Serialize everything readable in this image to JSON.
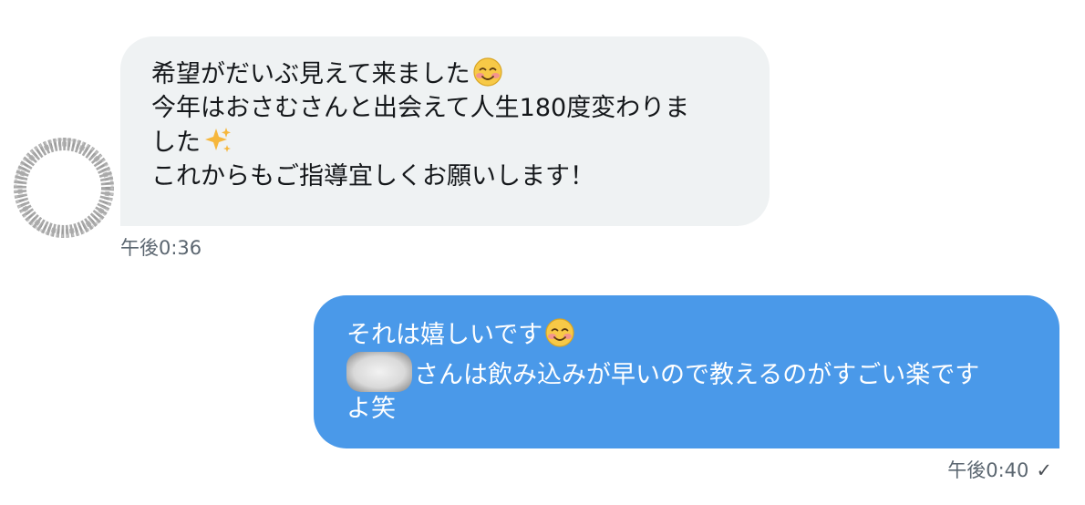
{
  "messages": {
    "incoming": {
      "lines": [
        "希望がだいぶ見えて来ました",
        "今年はおさむさんと出会えて人生180度変わりま",
        "した",
        "これからもご指導宜しくお願いします！"
      ],
      "emoji": [
        "smiling-face-icon",
        "sparkles-icon"
      ],
      "timestamp": "午後0:36"
    },
    "outgoing": {
      "lines": [
        "それは嬉しいです",
        "さんは飲み込みが早いので教えるのがすごい楽です",
        "よ笑"
      ],
      "emoji": [
        "smiling-face-icon"
      ],
      "timestamp": "午後0:40",
      "read_status": "✓"
    }
  },
  "colors": {
    "incoming_bubble": "#eff2f3",
    "outgoing_bubble": "#4a99e9",
    "text_dark": "#14171a",
    "timestamp": "#5b6670"
  }
}
